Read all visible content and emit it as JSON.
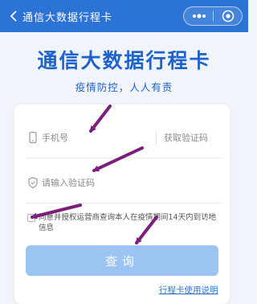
{
  "header": {
    "title": "通信大数据行程卡",
    "icons": {
      "back": "chevron-left-icon",
      "more": "more-dots-icon",
      "close": "record-circle-icon"
    }
  },
  "hero": {
    "title": "通信大数据行程卡",
    "subtitle": "疫情防控，人人有责"
  },
  "form": {
    "phone_placeholder": "手机号",
    "get_code_label": "获取验证码",
    "code_placeholder": "请输入验证码",
    "agreement_text": "同意并授权运营商查询本人在疫情期间14天内到访地信息",
    "agreement_checked": false,
    "submit_label": "查询",
    "help_link": "行程卡使用说明"
  },
  "colors": {
    "header_bg": "#2c73d6",
    "brand_blue": "#1e63cc",
    "button_bg": "#9cc4f2",
    "annotation_arrow": "#7b1f7a"
  }
}
